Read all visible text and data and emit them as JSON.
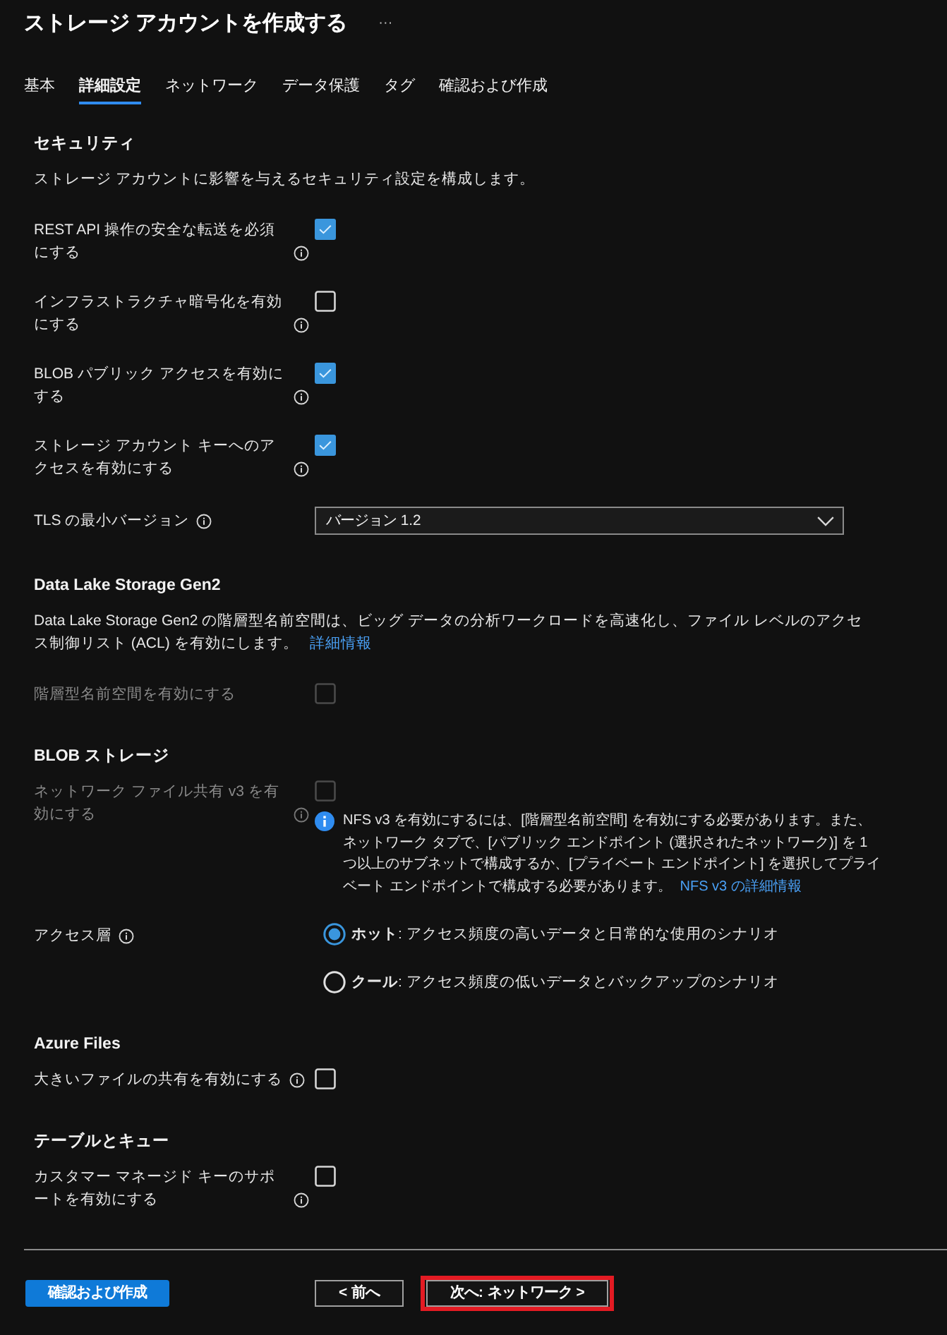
{
  "title": "ストレージ アカウントを作成する",
  "more": "···",
  "tabs": [
    {
      "label": "基本",
      "selected": false
    },
    {
      "label": "詳細設定",
      "selected": true
    },
    {
      "label": "ネットワーク",
      "selected": false
    },
    {
      "label": "データ保護",
      "selected": false
    },
    {
      "label": "タグ",
      "selected": false
    },
    {
      "label": "確認および作成",
      "selected": false
    }
  ],
  "sections": [
    {
      "heading": "セキュリティ",
      "description": "ストレージ アカウントに影響を与えるセキュリティ設定を構成します。",
      "fields": [
        {
          "kind": "checkbox",
          "label": "REST API 操作の安全な転送を必須にする",
          "info": true,
          "checked": true,
          "disabled": false
        },
        {
          "kind": "checkbox",
          "label": "インフラストラクチャ暗号化を有効にする",
          "info": true,
          "checked": false,
          "disabled": false
        },
        {
          "kind": "checkbox",
          "label": "BLOB パブリック アクセスを有効にする",
          "info": true,
          "checked": true,
          "disabled": false
        },
        {
          "kind": "checkbox",
          "label": "ストレージ アカウント キーへのアクセスを有効にする",
          "info": true,
          "checked": true,
          "disabled": false
        },
        {
          "kind": "dropdown",
          "label": "TLS の最小バージョン",
          "info": true,
          "value": "バージョン 1.2"
        }
      ]
    },
    {
      "heading": "Data Lake Storage Gen2",
      "description": "Data Lake Storage Gen2 の階層型名前空間は、ビッグ データの分析ワークロードを高速化し、ファイル レベルのアクセス制御リスト (ACL) を有効にします。",
      "link": "詳細情報",
      "fields": [
        {
          "kind": "checkbox",
          "label": "階層型名前空間を有効にする",
          "info": false,
          "checked": false,
          "disabled": true
        }
      ]
    },
    {
      "heading": "BLOB ストレージ",
      "fields": [
        {
          "kind": "checkbox",
          "label": "ネットワーク ファイル共有 v3 を有効にする",
          "info": true,
          "checked": false,
          "disabled": true,
          "note": {
            "text": "NFS v3 を有効にするには、[階層型名前空間] を有効にする必要があります。また、ネットワーク タブで、[パブリック エンドポイント (選択されたネットワーク)] を 1 つ以上のサブネットで構成するか、[プライベート エンドポイント] を選択してプライベート エンドポイントで構成する必要があります。",
            "link": "NFS v3 の詳細情報"
          }
        },
        {
          "kind": "radio",
          "label": "アクセス層",
          "info": true,
          "options": [
            {
              "text": "**ホット**: アクセス頻度の高いデータと日常的な使用のシナリオ",
              "selected": true
            },
            {
              "text": "**クール**: アクセス頻度の低いデータとバックアップのシナリオ",
              "selected": false
            }
          ]
        }
      ]
    },
    {
      "heading": "Azure Files",
      "fields": [
        {
          "kind": "checkbox",
          "label": "大きいファイルの共有を有効にする",
          "info": true,
          "checked": false,
          "disabled": false
        }
      ]
    },
    {
      "heading": "テーブルとキュー",
      "fields": [
        {
          "kind": "checkbox",
          "label": "カスタマー マネージド キーのサポートを有効にする",
          "info": true,
          "checked": false,
          "disabled": false
        }
      ]
    }
  ],
  "footer": {
    "buttons": [
      {
        "label": "確認および作成",
        "kind": "primary",
        "highlighted": false
      },
      {
        "label": "< 前へ",
        "kind": "secondary",
        "highlighted": false
      },
      {
        "label": "次へ: ネットワーク >",
        "kind": "secondary",
        "highlighted": true
      }
    ]
  }
}
